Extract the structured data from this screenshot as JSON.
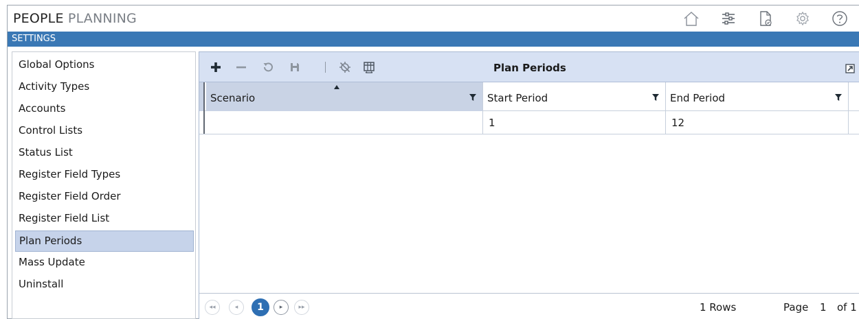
{
  "app": {
    "title_bold": "PEOPLE",
    "title_light": "PLANNING",
    "section": "SETTINGS",
    "top_icons": [
      "home-icon",
      "sliders-icon",
      "document-check-icon",
      "gear-icon",
      "help-icon"
    ]
  },
  "nav": {
    "items": [
      {
        "label": "Global Options"
      },
      {
        "label": "Activity Types"
      },
      {
        "label": "Accounts"
      },
      {
        "label": "Control Lists"
      },
      {
        "label": "Status List"
      },
      {
        "label": "Register Field Types"
      },
      {
        "label": "Register Field Order"
      },
      {
        "label": "Register Field List"
      },
      {
        "label": "Plan Periods"
      },
      {
        "label": "Mass Update"
      },
      {
        "label": "Uninstall"
      }
    ],
    "active": "Plan Periods"
  },
  "panel": {
    "title": "Plan Periods",
    "toolbar_icons": [
      "add-icon",
      "remove-icon",
      "refresh-icon",
      "save-icon",
      "clear-filter-icon",
      "column-chooser-icon",
      "expand-icon"
    ]
  },
  "grid": {
    "columns": [
      {
        "label": "Scenario",
        "sorted": "ascending"
      },
      {
        "label": "Start Period"
      },
      {
        "label": "End Period"
      }
    ],
    "rows": [
      {
        "scenario": "",
        "start": "1",
        "end": "12"
      }
    ]
  },
  "pager": {
    "current_page": "1",
    "rows_text": "1 Rows",
    "page_label": "Page",
    "page_value": "1",
    "of_text": "of 1"
  },
  "colors": {
    "settings_bar": "#3a78b5",
    "toolbar_bg": "#d7e1f3",
    "active_nav": "#c6d3ea",
    "pager_current": "#2e6fb3"
  }
}
